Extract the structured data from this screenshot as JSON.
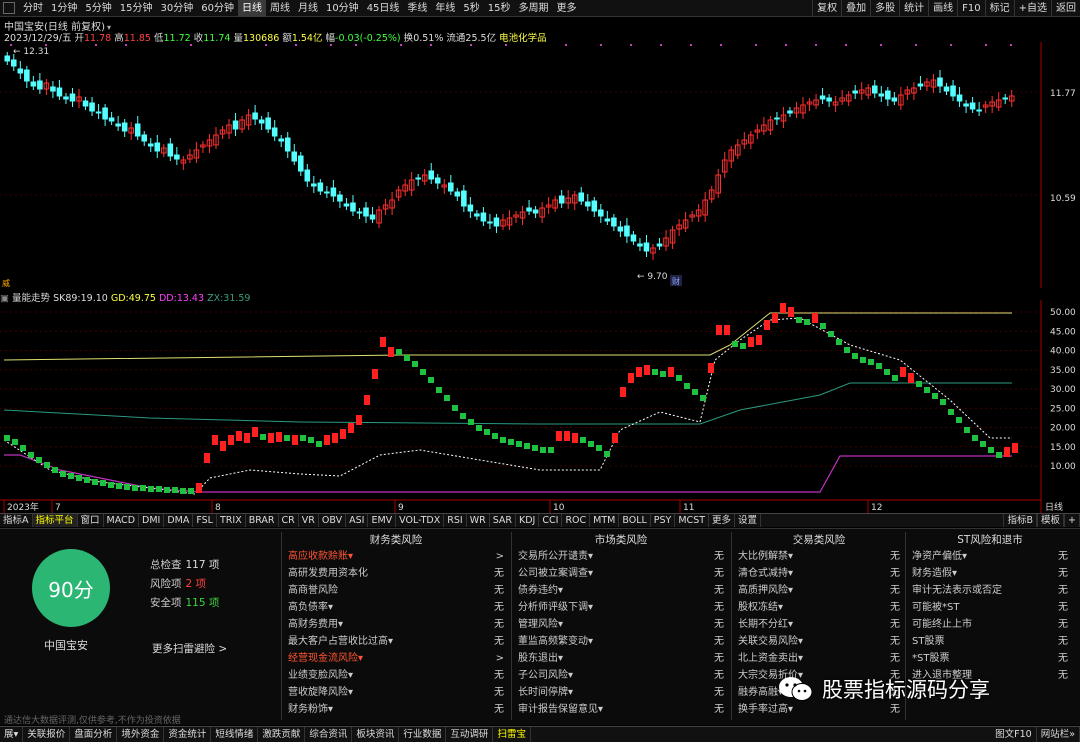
{
  "topbar": {
    "periods": [
      "分时",
      "1分钟",
      "5分钟",
      "15分钟",
      "30分钟",
      "60分钟",
      "日线",
      "周线",
      "月线",
      "10分钟",
      "45日线",
      "季线",
      "年线",
      "5秒",
      "15秒",
      "多周期",
      "更多"
    ],
    "active_period": "日线",
    "right_buttons": [
      "复权",
      "叠加",
      "多股",
      "统计",
      "画线",
      "F10",
      "标记",
      "+自选",
      "返回"
    ]
  },
  "stock": {
    "title": "中国宝安(日线 前复权)",
    "date": "2023/12/29/五",
    "open_label": "开",
    "open": "11.78",
    "high_label": "高",
    "high": "11.85",
    "low_label": "低",
    "low": "11.72",
    "close_label": "收",
    "close": "11.74",
    "vol_label": "量",
    "vol": "130686",
    "amt_label": "额",
    "amt": "1.54亿",
    "chg_label": "幅",
    "chg": "-0.03(-0.25%)",
    "turn_label": "换",
    "turn": "0.51%",
    "float_label": "流通",
    "float": "25.5亿",
    "sector": "电池化学品"
  },
  "kchart": {
    "price_labels": [
      "11.77",
      "10.59"
    ],
    "high_marker": "12.31",
    "low_marker": "9.70",
    "cai_badge": "财",
    "left_badge": "威",
    "month_labels": [
      "2023年",
      "7",
      "8",
      "9",
      "10",
      "11",
      "12"
    ],
    "right_label": "日线"
  },
  "indicator": {
    "name": "量能走势",
    "sk_label": "SK89:",
    "sk": "19.10",
    "gd_label": "GD:",
    "gd": "49.75",
    "dd_label": "DD:",
    "dd": "13.43",
    "zx_label": "ZX:",
    "zx": "31.59",
    "y_ticks": [
      "50.00",
      "45.00",
      "40.00",
      "35.00",
      "30.00",
      "25.00",
      "20.00",
      "15.00",
      "10.00"
    ]
  },
  "tabs": {
    "items": [
      "指标A",
      "指标平台",
      "窗口",
      "MACD",
      "DMI",
      "DMA",
      "FSL",
      "TRIX",
      "BRAR",
      "CR",
      "VR",
      "OBV",
      "ASI",
      "EMV",
      "VOL-TDX",
      "RSI",
      "WR",
      "SAR",
      "KDJ",
      "CCI",
      "ROC",
      "MTM",
      "BOLL",
      "PSY",
      "MCST",
      "更多",
      "设置"
    ],
    "active": "指标平台",
    "right": [
      "指标B",
      "模板",
      "+"
    ]
  },
  "risk": {
    "score": "90分",
    "name": "中国宝安",
    "total_label": "总检查",
    "total": "117 项",
    "risk_label": "风险项",
    "risk_count": "2 项",
    "safe_label": "安全项",
    "safe": "115 项",
    "more": "更多扫雷避险 >",
    "footnote": "通达信大数据评测,仅供参考,不作为投资依据",
    "columns": [
      {
        "title": "财务类风险",
        "rows": [
          {
            "k": "高应收款赊账▾",
            "v": ">",
            "red": true
          },
          {
            "k": "高研发费用资本化",
            "v": "无"
          },
          {
            "k": "高商誉风险",
            "v": "无"
          },
          {
            "k": "高负债率▾",
            "v": "无"
          },
          {
            "k": "高财务费用▾",
            "v": "无"
          },
          {
            "k": "最大客户占营收比过高▾",
            "v": "无"
          },
          {
            "k": "经营现金流风险▾",
            "v": ">",
            "red": true
          },
          {
            "k": "业绩变脸风险▾",
            "v": "无"
          },
          {
            "k": "营收旋降风险▾",
            "v": "无"
          },
          {
            "k": "财务粉饰▾",
            "v": "无"
          }
        ]
      },
      {
        "title": "市场类风险",
        "rows": [
          {
            "k": "交易所公开谴责▾",
            "v": "无"
          },
          {
            "k": "公司被立案调查▾",
            "v": "无"
          },
          {
            "k": "债券违约▾",
            "v": "无"
          },
          {
            "k": "分析师评级下调▾",
            "v": "无"
          },
          {
            "k": "管理风险▾",
            "v": "无"
          },
          {
            "k": "董监高频繁变动▾",
            "v": "无"
          },
          {
            "k": "股东退出▾",
            "v": "无"
          },
          {
            "k": "子公司风险▾",
            "v": "无"
          },
          {
            "k": "长时间停牌▾",
            "v": "无"
          },
          {
            "k": "审计报告保留意见▾",
            "v": "无"
          }
        ]
      },
      {
        "title": "交易类风险",
        "rows": [
          {
            "k": "大比例解禁▾",
            "v": "无"
          },
          {
            "k": "清仓式减持▾",
            "v": "无"
          },
          {
            "k": "高质押风险▾",
            "v": "无"
          },
          {
            "k": "股权冻结▾",
            "v": "无"
          },
          {
            "k": "长期不分红▾",
            "v": "无"
          },
          {
            "k": "关联交易风险▾",
            "v": "无"
          },
          {
            "k": "北上资金卖出▾",
            "v": "无"
          },
          {
            "k": "大宗交易折价▾",
            "v": "无"
          },
          {
            "k": "融券高融▾",
            "v": "无"
          },
          {
            "k": "换手率过高▾",
            "v": "无"
          }
        ]
      },
      {
        "title": "ST风险和退市",
        "rows": [
          {
            "k": "净资产偏低▾",
            "v": "无"
          },
          {
            "k": "财务造假▾",
            "v": "无"
          },
          {
            "k": "审计无法表示或否定",
            "v": "无"
          },
          {
            "k": "可能被*ST",
            "v": "无"
          },
          {
            "k": "可能终止上市",
            "v": "无"
          },
          {
            "k": "ST股票",
            "v": "无"
          },
          {
            "k": "*ST股票",
            "v": "无"
          },
          {
            "k": "进入退市整理",
            "v": "无"
          }
        ]
      }
    ]
  },
  "bottombar": {
    "items": [
      "展▾",
      "关联报价",
      "盘面分析",
      "境外资金",
      "资金统计",
      "短线情绪",
      "激跌贡献",
      "综合资讯",
      "板块资讯",
      "行业数据",
      "互动调研",
      "扫雷宝"
    ],
    "active": "扫雷宝",
    "right": [
      "图文F10",
      "网站栏»"
    ]
  },
  "watermark": {
    "text": "股票指标源码分享"
  },
  "colors": {
    "up": "#ff3030",
    "down": "#54ffff",
    "ind_up": "#ff2020",
    "ind_down": "#20c040"
  }
}
